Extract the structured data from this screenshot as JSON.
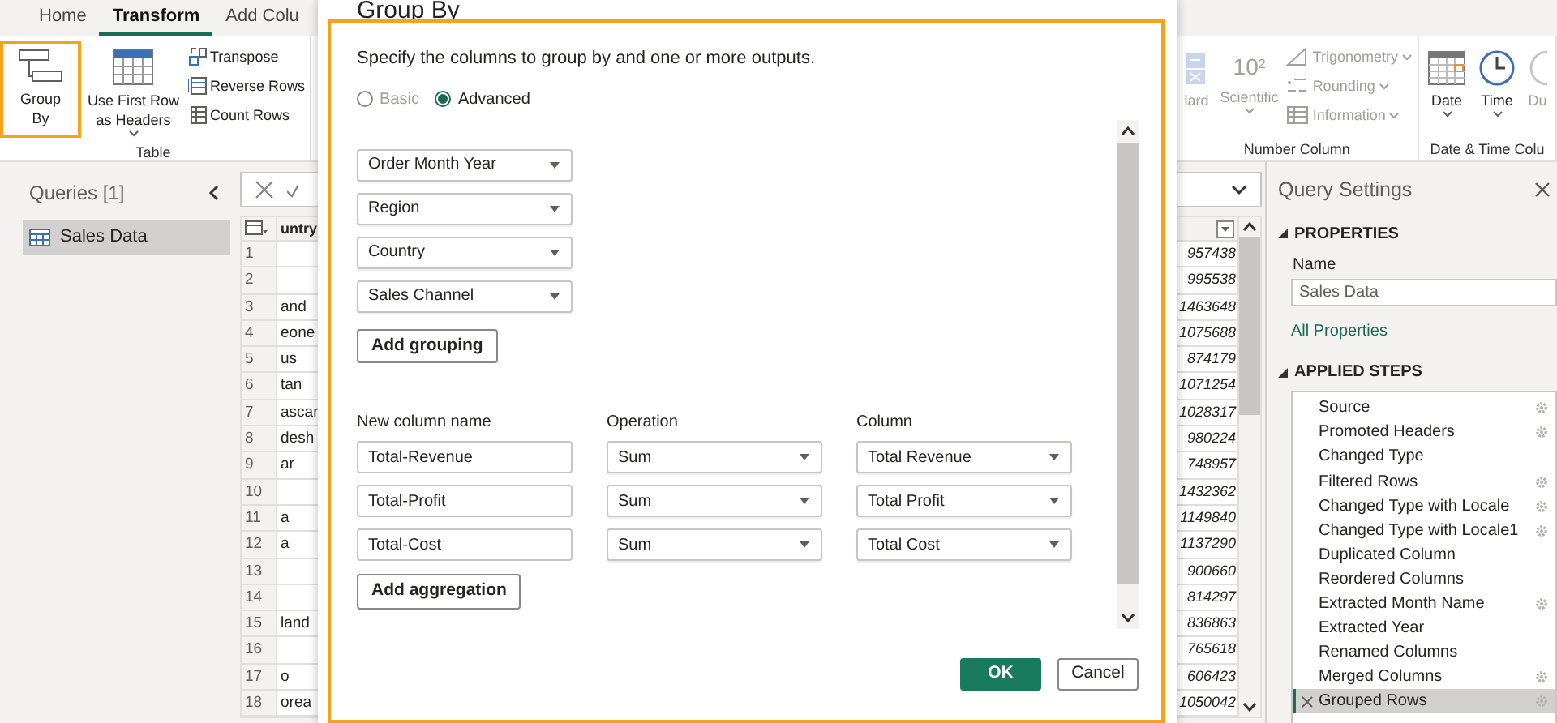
{
  "ribbon_tabs": [
    {
      "label": "Home",
      "selected": false
    },
    {
      "label": "Transform",
      "selected": true
    },
    {
      "label": "Add Colu",
      "selected": false
    }
  ],
  "ribbon_groups": [
    {
      "label": "Table",
      "items": [
        {
          "kind": "large",
          "lines": [
            "Group",
            "By"
          ],
          "highlighted": true,
          "dropdown": false,
          "disabled": false
        },
        {
          "kind": "large",
          "lines": [
            "Use First Row",
            "as Headers"
          ],
          "highlighted": false,
          "dropdown": true,
          "disabled": false
        },
        {
          "kind": "stack",
          "entries": [
            {
              "label": "Transpose",
              "dropdown": false,
              "disabled": false
            },
            {
              "label": "Reverse Rows",
              "dropdown": false,
              "disabled": false
            },
            {
              "label": "Count Rows",
              "dropdown": false,
              "disabled": false
            }
          ]
        }
      ]
    },
    {
      "label": "Number Column",
      "items": [
        {
          "kind": "large",
          "lines": [
            "lard"
          ],
          "highlighted": false,
          "dropdown": false,
          "disabled": true
        },
        {
          "kind": "large",
          "glyph": "10$^{2}$",
          "lines": [
            "Scientific"
          ],
          "highlighted": false,
          "dropdown": true,
          "disabled": true
        },
        {
          "kind": "stack",
          "entries": [
            {
              "label": "Trigonometry",
              "dropdown": true,
              "disabled": true
            },
            {
              "label": "Rounding",
              "dropdown": true,
              "disabled": true
            },
            {
              "label": "Information",
              "dropdown": true,
              "disabled": true
            }
          ]
        }
      ]
    },
    {
      "label": "Date & Time Colu",
      "items": [
        {
          "kind": "large",
          "lines": [
            "Date"
          ],
          "highlighted": false,
          "dropdown": true,
          "disabled": false
        },
        {
          "kind": "large",
          "lines": [
            "Time"
          ],
          "highlighted": false,
          "dropdown": true,
          "disabled": false
        },
        {
          "kind": "large",
          "lines": [
            "Du"
          ],
          "highlighted": false,
          "dropdown": false,
          "disabled": true
        }
      ]
    }
  ],
  "queries": {
    "title": "Queries [1]",
    "items": [
      {
        "label": "Sales Data",
        "selected": true
      }
    ]
  },
  "grid": {
    "columns": [
      "untry"
    ],
    "rows": [
      {
        "number": "1",
        "cell_2": "957438"
      },
      {
        "number": "2",
        "cell_2": "995538"
      },
      {
        "number": "3",
        "cell_1": "and",
        "cell_2": "1463648"
      },
      {
        "number": "4",
        "cell_1": "eone",
        "cell_2": "1075688"
      },
      {
        "number": "5",
        "cell_1": "us",
        "cell_2": "874179"
      },
      {
        "number": "6",
        "cell_1": "tan",
        "cell_2": "1071254"
      },
      {
        "number": "7",
        "cell_1": "ascar",
        "cell_2": "1028317"
      },
      {
        "number": "8",
        "cell_1": "desh",
        "cell_2": "980224"
      },
      {
        "number": "9",
        "cell_1": "ar",
        "cell_2": "748957"
      },
      {
        "number": "10",
        "cell_2": "1432362"
      },
      {
        "number": "11",
        "cell_1": "a",
        "cell_2": "1149840"
      },
      {
        "number": "12",
        "cell_1": "a",
        "cell_2": "1137290"
      },
      {
        "number": "13",
        "cell_2": "900660"
      },
      {
        "number": "14",
        "cell_2": "814297"
      },
      {
        "number": "15",
        "cell_1": "land",
        "cell_2": "836863"
      },
      {
        "number": "16",
        "cell_2": "765618"
      },
      {
        "number": "17",
        "cell_1": "o",
        "cell_2": "606423"
      },
      {
        "number": "18",
        "cell_1": "orea",
        "cell_2": "1050042"
      }
    ]
  },
  "query_settings": {
    "title": "Query Settings",
    "properties_heading": "PROPERTIES",
    "name_label": "Name",
    "name_value": "Sales Data",
    "all_properties_link": "All Properties",
    "steps_heading": "APPLIED STEPS",
    "steps": [
      {
        "label": "Source",
        "settings": true,
        "selected": false
      },
      {
        "label": "Promoted Headers",
        "settings": true,
        "selected": false
      },
      {
        "label": "Changed Type",
        "settings": false,
        "selected": false
      },
      {
        "label": "Filtered Rows",
        "settings": true,
        "selected": false
      },
      {
        "label": "Changed Type with Locale",
        "settings": true,
        "selected": false
      },
      {
        "label": "Changed Type with Locale1",
        "settings": true,
        "selected": false
      },
      {
        "label": "Duplicated Column",
        "settings": false,
        "selected": false
      },
      {
        "label": "Reordered Columns",
        "settings": false,
        "selected": false
      },
      {
        "label": "Extracted Month Name",
        "settings": true,
        "selected": false
      },
      {
        "label": "Extracted Year",
        "settings": false,
        "selected": false
      },
      {
        "label": "Renamed Columns",
        "settings": false,
        "selected": false
      },
      {
        "label": "Merged Columns",
        "settings": true,
        "selected": false
      },
      {
        "label": "Grouped Rows",
        "settings": true,
        "selected": true
      }
    ]
  },
  "dialog": {
    "title": "Group By",
    "highlighted": true,
    "description": "Specify the columns to group by and one or more outputs.",
    "modes": [
      {
        "label": "Basic",
        "selected": false
      },
      {
        "label": "Advanced",
        "selected": true
      }
    ],
    "grouping": [
      "Order Month Year",
      "Region",
      "Country",
      "Sales Channel"
    ],
    "add_grouping": "Add grouping",
    "aggregation_headers": [
      "New column name",
      "Operation",
      "Column"
    ],
    "aggregations": [
      {
        "name": "Total-Revenue",
        "operation": "Sum",
        "column": "Total Revenue"
      },
      {
        "name": "Total-Profit",
        "operation": "Sum",
        "column": "Total Profit"
      },
      {
        "name": "Total-Cost",
        "operation": "Sum",
        "column": "Total Cost"
      }
    ],
    "add_aggregation": "Add aggregation",
    "buttons": [
      {
        "label": "OK",
        "kind": "primary"
      },
      {
        "label": "Cancel",
        "kind": "secondary"
      }
    ]
  }
}
